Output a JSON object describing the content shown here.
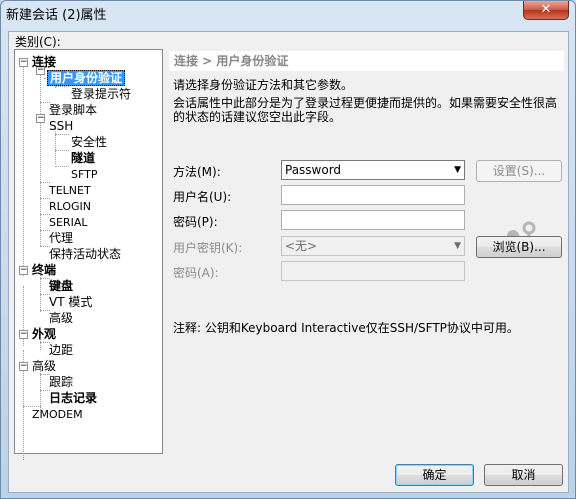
{
  "window": {
    "title": "新建会话 (2)属性",
    "close_glyph": "✕"
  },
  "category_label": "类别(C):",
  "tree": [
    {
      "label": "连接",
      "bold": true
    },
    {
      "label": "用户身份验证",
      "bold": true,
      "selected": true
    },
    {
      "label": "登录提示符"
    },
    {
      "label": "登录脚本"
    },
    {
      "label": "SSH"
    },
    {
      "label": "安全性"
    },
    {
      "label": "隧道",
      "bold": true
    },
    {
      "label": "SFTP"
    },
    {
      "label": "TELNET"
    },
    {
      "label": "RLOGIN"
    },
    {
      "label": "SERIAL"
    },
    {
      "label": "代理"
    },
    {
      "label": "保持活动状态"
    },
    {
      "label": "终端",
      "bold": true
    },
    {
      "label": "键盘",
      "bold": true
    },
    {
      "label": "VT 模式"
    },
    {
      "label": "高级"
    },
    {
      "label": "外观",
      "bold": true
    },
    {
      "label": "边距"
    },
    {
      "label": "高级"
    },
    {
      "label": "跟踪"
    },
    {
      "label": "日志记录",
      "bold": true
    },
    {
      "label": "ZMODEM"
    }
  ],
  "panel": {
    "header": "连接 > 用户身份验证",
    "desc1": "请选择身份验证方法和其它参数。",
    "desc2": "会话属性中此部分是为了登录过程更便捷而提供的。如果需要安全性很高",
    "desc3": "的状态的话建议您空出此字段。",
    "method_label": "方法(M):",
    "method_value": "Password",
    "settings_button": "设置(S)...",
    "username_label": "用户名(U):",
    "username_value": "",
    "password_label": "密码(P):",
    "password_value": "",
    "userkey_label": "用户密钥(K):",
    "userkey_value": "<无>",
    "browse_button": "浏览(B)...",
    "passphrase_label": "密码(A):",
    "passphrase_value": "",
    "note": "注释: 公钥和Keyboard Interactive仅在SSH/SFTP协议中可用。"
  },
  "buttons": {
    "ok": "确定",
    "cancel": "取消"
  },
  "icons": {
    "key": "user-key-icon",
    "dropdown": "chevron-down-icon"
  }
}
